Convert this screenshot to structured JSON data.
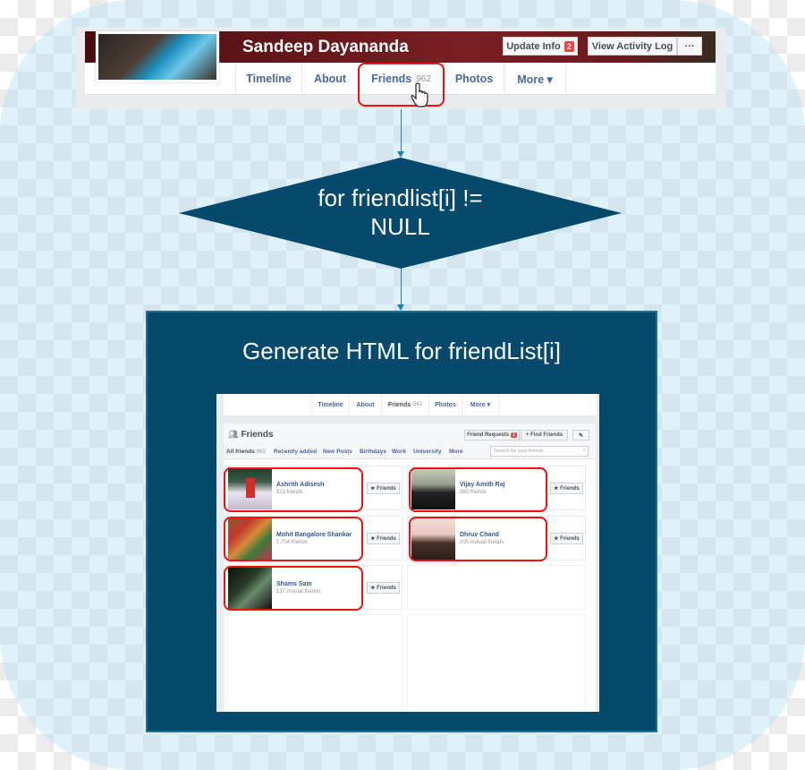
{
  "top_screenshot": {
    "profile_name": "Sandeep Dayananda",
    "update_info_label": "Update Info",
    "update_info_badge": "2",
    "activity_log_label": "View Activity Log",
    "more_options_label": "···",
    "tabs": [
      {
        "label": "Timeline"
      },
      {
        "label": "About"
      },
      {
        "label": "Friends",
        "count": "962"
      },
      {
        "label": "Photos"
      },
      {
        "label": "More ▾"
      }
    ],
    "highlight_color": "#ee1111"
  },
  "decision": {
    "line1": "for friendlist[i] !=",
    "line2": "NULL",
    "color": "#054a6c"
  },
  "process": {
    "title": "Generate HTML for friendList[i]",
    "color": "#054a6c"
  },
  "inner_screenshot": {
    "tabs": [
      {
        "label": "Timeline"
      },
      {
        "label": "About"
      },
      {
        "label": "Friends",
        "count": "962"
      },
      {
        "label": "Photos"
      },
      {
        "label": "More ▾"
      }
    ],
    "section_title": "Friends",
    "friend_requests_label": "Friend Requests",
    "friend_requests_badge": "1",
    "find_friends_label": "+ Find Friends",
    "edit_icon": "pencil-icon",
    "filters": [
      {
        "label": "All friends",
        "count": "962"
      },
      {
        "label": "Recently added"
      },
      {
        "label": "New Posts"
      },
      {
        "label": "Birthdays"
      },
      {
        "label": "Work"
      },
      {
        "label": "University"
      },
      {
        "label": "More"
      }
    ],
    "search_placeholder": "Search for your friends",
    "friend_button_label": "★ Friends",
    "friends": [
      {
        "name": "Ashrith Adisesh",
        "sub": "813 friends"
      },
      {
        "name": "Vijay Amith Raj",
        "sub": "360 friends"
      },
      {
        "name": "Mohit Bangalore Shankar",
        "sub": "1,704 friends"
      },
      {
        "name": "Dhruv Chand",
        "sub": "205 mutual friends"
      },
      {
        "name": "Shams Sam",
        "sub": "137 mutual friends"
      }
    ]
  }
}
